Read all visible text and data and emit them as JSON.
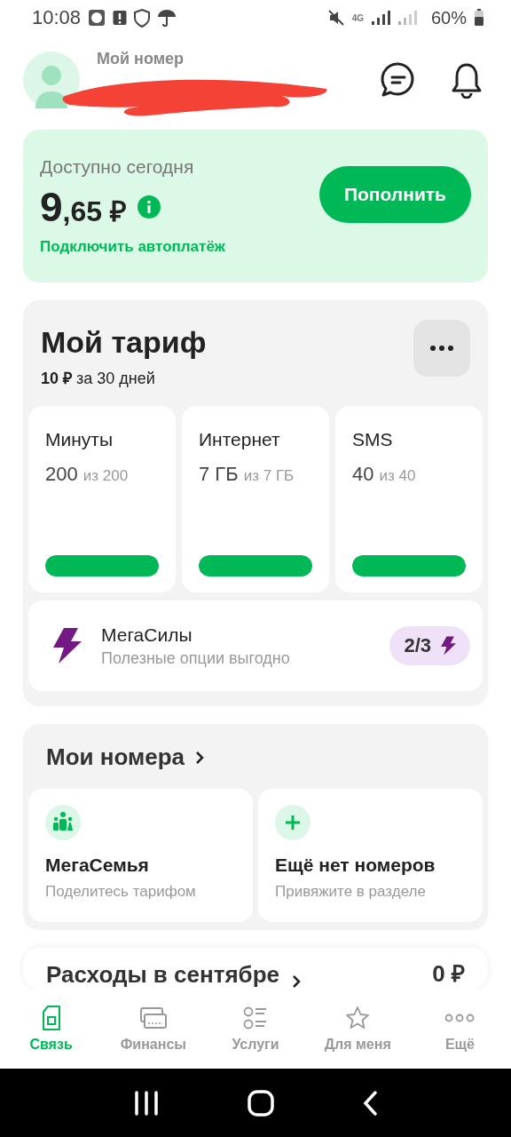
{
  "status_bar": {
    "time": "10:08",
    "network": "4G",
    "battery": "60%"
  },
  "header": {
    "label": "Мой номер"
  },
  "balance": {
    "title": "Доступно сегодня",
    "amount_main": "9",
    "amount_fraction": ",65 ₽",
    "button": "Пополнить",
    "link": "Подключить автоплатёж"
  },
  "tariff": {
    "title": "Мой тариф",
    "price": "10 ₽",
    "period": "за 30 дней",
    "packages": [
      {
        "name": "Минуты",
        "remaining": "200",
        "total": "из 200",
        "level": 1
      },
      {
        "name": "Интернет",
        "remaining": "7 ГБ",
        "total": "из 7 ГБ",
        "level": 1
      },
      {
        "name": "SMS",
        "remaining": "40",
        "total": "из 40",
        "level": 1
      }
    ],
    "megasily": {
      "title": "МегаСилы",
      "subtitle": "Полезные опции выгодно",
      "badge": "2/3"
    }
  },
  "my_numbers": {
    "title": "Мои номера",
    "cards": [
      {
        "kind": "family",
        "title": "МегаСемья",
        "subtitle": "Поделитесь тарифом"
      },
      {
        "kind": "add",
        "title": "Ещё нет номеров",
        "subtitle": "Привяжите в разделе"
      }
    ]
  },
  "expenses": {
    "title": "Расходы в сентябре",
    "amount": "0 ₽"
  },
  "tabs": [
    {
      "label": "Связь",
      "kind": "sim",
      "selected": true
    },
    {
      "label": "Финансы",
      "kind": "cards",
      "selected": false
    },
    {
      "label": "Услуги",
      "kind": "list",
      "selected": false
    },
    {
      "label": "Для меня",
      "kind": "star",
      "selected": false
    },
    {
      "label": "Ещё",
      "kind": "more",
      "selected": false
    }
  ]
}
